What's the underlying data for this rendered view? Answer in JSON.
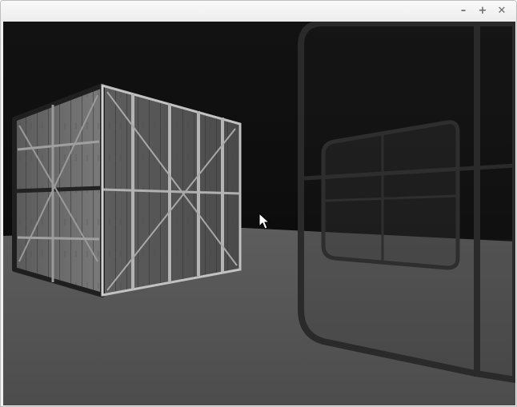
{
  "window": {
    "controls": {
      "minimize": "–",
      "maximize": "+",
      "close": "✕"
    }
  },
  "scene": {
    "sky_color": "#0f0f0f",
    "floor_color": "#5a5a5a",
    "crate_wood_color": "#6e6e6e",
    "crate_frame_color": "#b4b4b4",
    "glass_frame_color": "#2b2b2b",
    "cursor": "mouse-pointer-icon"
  }
}
